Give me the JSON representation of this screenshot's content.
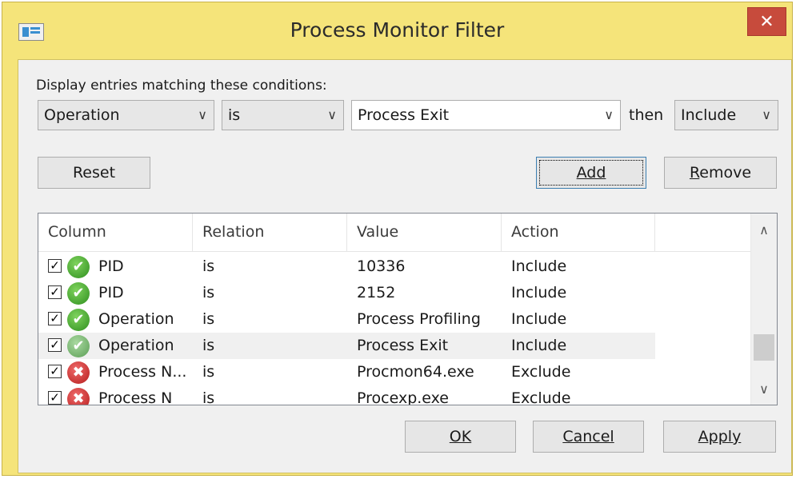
{
  "window": {
    "title": "Process Monitor Filter",
    "close_glyph": "✕",
    "accent_color": "#f5e47a",
    "close_color": "#c74b3c"
  },
  "filter": {
    "prompt": "Display entries matching these conditions:",
    "column_value": "Operation",
    "relation_value": "is",
    "value_value": "Process Exit",
    "then_label": "then",
    "action_value": "Include"
  },
  "buttons": {
    "reset": "Reset",
    "add": "Add",
    "remove_prefix": "R",
    "remove_rest": "emove",
    "ok": "OK",
    "cancel": "Cancel",
    "apply": "Apply"
  },
  "table": {
    "columns": [
      "Column",
      "Relation",
      "Value",
      "Action"
    ],
    "rows": [
      {
        "column": "PID",
        "relation": "is",
        "value": "10336",
        "action": "Include",
        "status": "ok",
        "checked": true
      },
      {
        "column": "PID",
        "relation": "is",
        "value": "2152",
        "action": "Include",
        "status": "ok",
        "checked": true
      },
      {
        "column": "Operation",
        "relation": "is",
        "value": "Process Profiling",
        "action": "Include",
        "status": "ok",
        "checked": true
      },
      {
        "column": "Operation",
        "relation": "is",
        "value": "Process Exit",
        "action": "Include",
        "status": "ok-dim",
        "checked": true,
        "selected": true
      },
      {
        "column": "Process N...",
        "relation": "is",
        "value": "Procmon64.exe",
        "action": "Exclude",
        "status": "bad",
        "checked": true
      },
      {
        "column": "Process N",
        "relation": "is",
        "value": "Procexp.exe",
        "action": "Exclude",
        "status": "bad",
        "checked": true
      }
    ]
  },
  "icons": {
    "check_glyph": "✓",
    "ok_glyph": "✔",
    "bad_glyph": "✖",
    "dropdown": "chevron-down-icon",
    "scroll_up_glyph": "∧",
    "scroll_down_glyph": "∨",
    "chevron_glyph": "∨"
  }
}
